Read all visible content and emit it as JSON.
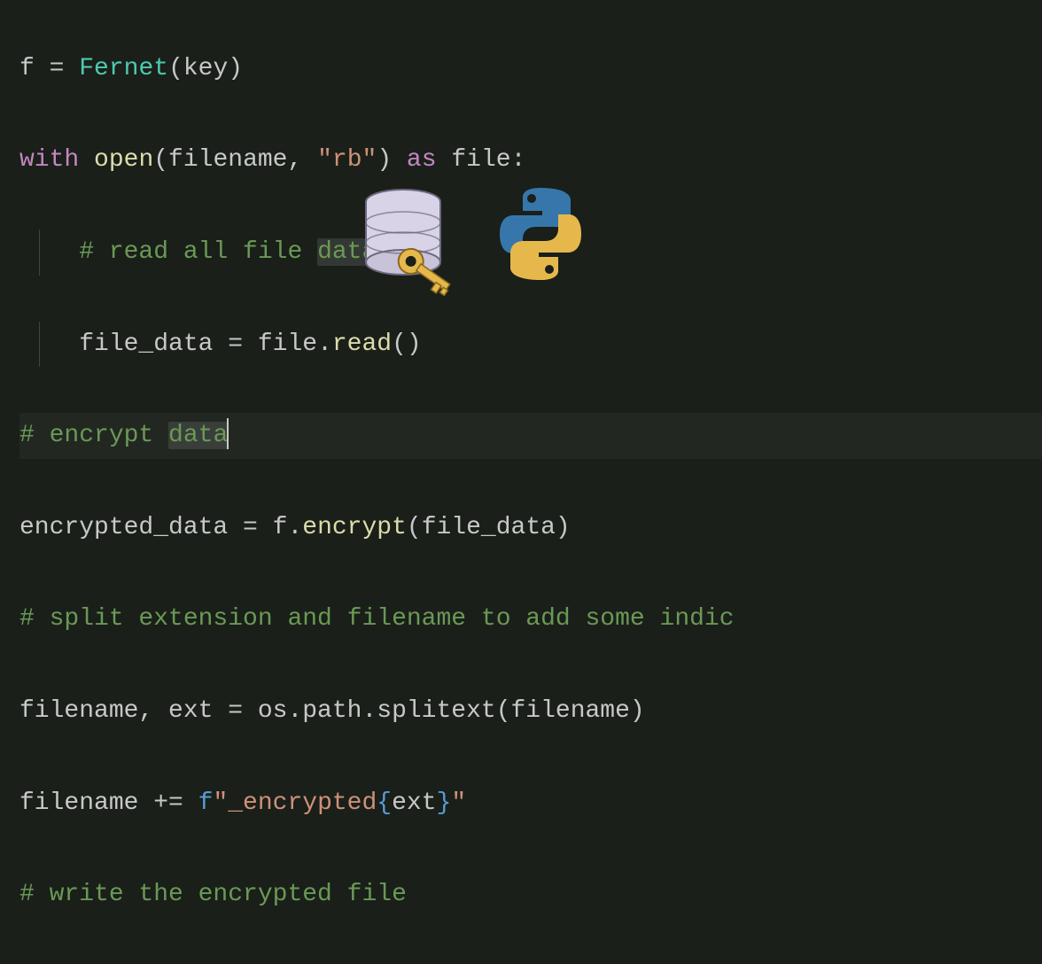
{
  "code": {
    "l1": {
      "f": "f",
      "eq": " = ",
      "fernet": "Fernet",
      "paren": "(key)"
    },
    "l2": {
      "with": "with",
      "sp1": " ",
      "open": "open",
      "args_open": "(filename, ",
      "str": "\"rb\"",
      "args_close": ") ",
      "as": "as",
      "sp2": " ",
      "file": "file",
      "colon": ":"
    },
    "l3": {
      "indent": "    ",
      "cmt_pre": "# read all file ",
      "cmt_hl": "data"
    },
    "l4": {
      "indent": "    ",
      "lhs": "file_data = file.",
      "read": "read",
      "parens": "()"
    },
    "l5": {
      "cmt_pre": "# encrypt ",
      "cmt_hl": "data"
    },
    "l6": {
      "lhs": "encrypted_data = f.",
      "enc": "encrypt",
      "args": "(file_data)"
    },
    "l7": {
      "cmt": "# split extension and filename to add some indic"
    },
    "l8": {
      "txt": "filename, ext = os.path.splitext(filename)"
    },
    "l9": {
      "lhs": "filename += ",
      "fpre": "f",
      "s1": "\"_encrypted",
      "brace_o": "{",
      "extv": "ext",
      "brace_c": "}",
      "s2": "\""
    },
    "l10": {
      "cmt": "# write the encrypted file"
    }
  },
  "icons": {
    "database": "database-icon",
    "key": "key-icon",
    "python": "python-icon"
  }
}
